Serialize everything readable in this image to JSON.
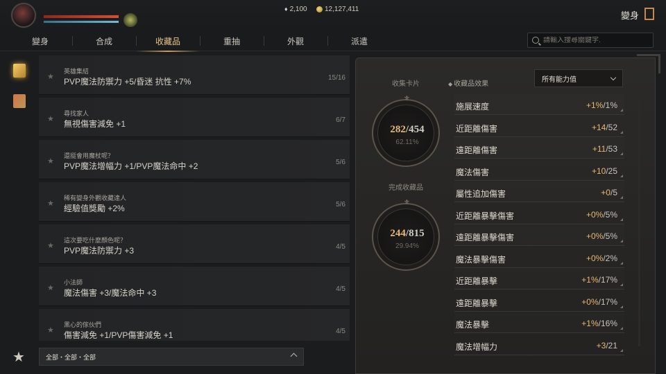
{
  "header": {
    "gem_amount": "2,100",
    "gold_amount": "12,127,411",
    "transform_label": "變身",
    "icons": [
      "avatar",
      "gem-icon",
      "coin-icon",
      "buff-icon",
      "exit-icon"
    ]
  },
  "tabs": [
    {
      "label": "變身"
    },
    {
      "label": "合成"
    },
    {
      "label": "收藏品",
      "active": true
    },
    {
      "label": "重抽"
    },
    {
      "label": "外觀"
    },
    {
      "label": "派遣"
    }
  ],
  "search": {
    "placeholder": "請輸入搜尋關鍵字."
  },
  "collections": [
    {
      "title": "英雄集結",
      "effect": "PVP魔法防禦力 +5/昏迷 抗性 +7%",
      "count": "15/16"
    },
    {
      "title": "尋找家人",
      "effect": "無視傷害減免 +1",
      "count": "6/7"
    },
    {
      "title": "還挺會用魔杖呢？",
      "effect": "PVP魔法增幅力 +1/PVP魔法命中 +2",
      "count": "5/6"
    },
    {
      "title": "稀有變身外觀收藏達人",
      "effect": "經驗值獎勵 +2%",
      "count": "5/6"
    },
    {
      "title": "這次要吃什麼顏色呢？",
      "effect": "PVP魔法防禦力 +3",
      "count": "4/5"
    },
    {
      "title": "小法師",
      "effect": "魔法傷害 +3/魔法命中 +3",
      "count": "4/5"
    },
    {
      "title": "黑心的傢伙們",
      "effect": "傷害減免 +1/PVP傷害減免 +1",
      "count": "4/5"
    }
  ],
  "filter": {
    "text": "全部・全部・全部"
  },
  "stats": {
    "cards_heading": "收集卡片",
    "cards_current": "282",
    "cards_total": "/454",
    "cards_percent": "62.11%",
    "complete_heading": "完成收藏品",
    "complete_current": "244",
    "complete_total": "/815",
    "complete_percent": "29.94%"
  },
  "effects": {
    "heading": "收藏品效果",
    "dropdown_value": "所有能力值",
    "items": [
      {
        "name": "施展速度",
        "gain": "+1%",
        "max": "/1%"
      },
      {
        "name": "近距離傷害",
        "gain": "+14",
        "max": "/52"
      },
      {
        "name": "遠距離傷害",
        "gain": "+11",
        "max": "/53"
      },
      {
        "name": "魔法傷害",
        "gain": "+10",
        "max": "/25"
      },
      {
        "name": "屬性追加傷害",
        "gain": "+0",
        "max": "/5"
      },
      {
        "name": "近距離暴擊傷害",
        "gain": "+0%",
        "max": "/5%"
      },
      {
        "name": "遠距離暴擊傷害",
        "gain": "+0%",
        "max": "/5%"
      },
      {
        "name": "魔法暴擊傷害",
        "gain": "+0%",
        "max": "/2%"
      },
      {
        "name": "近距離暴擊",
        "gain": "+1%",
        "max": "/17%"
      },
      {
        "name": "遠距離暴擊",
        "gain": "+0%",
        "max": "/17%"
      },
      {
        "name": "魔法暴擊",
        "gain": "+1%",
        "max": "/16%"
      },
      {
        "name": "魔法增幅力",
        "gain": "+3",
        "max": "/21"
      }
    ]
  },
  "colors": {
    "accent": "#e8c68a",
    "gain": "#e6b874",
    "bg": "#1b1c1e"
  }
}
